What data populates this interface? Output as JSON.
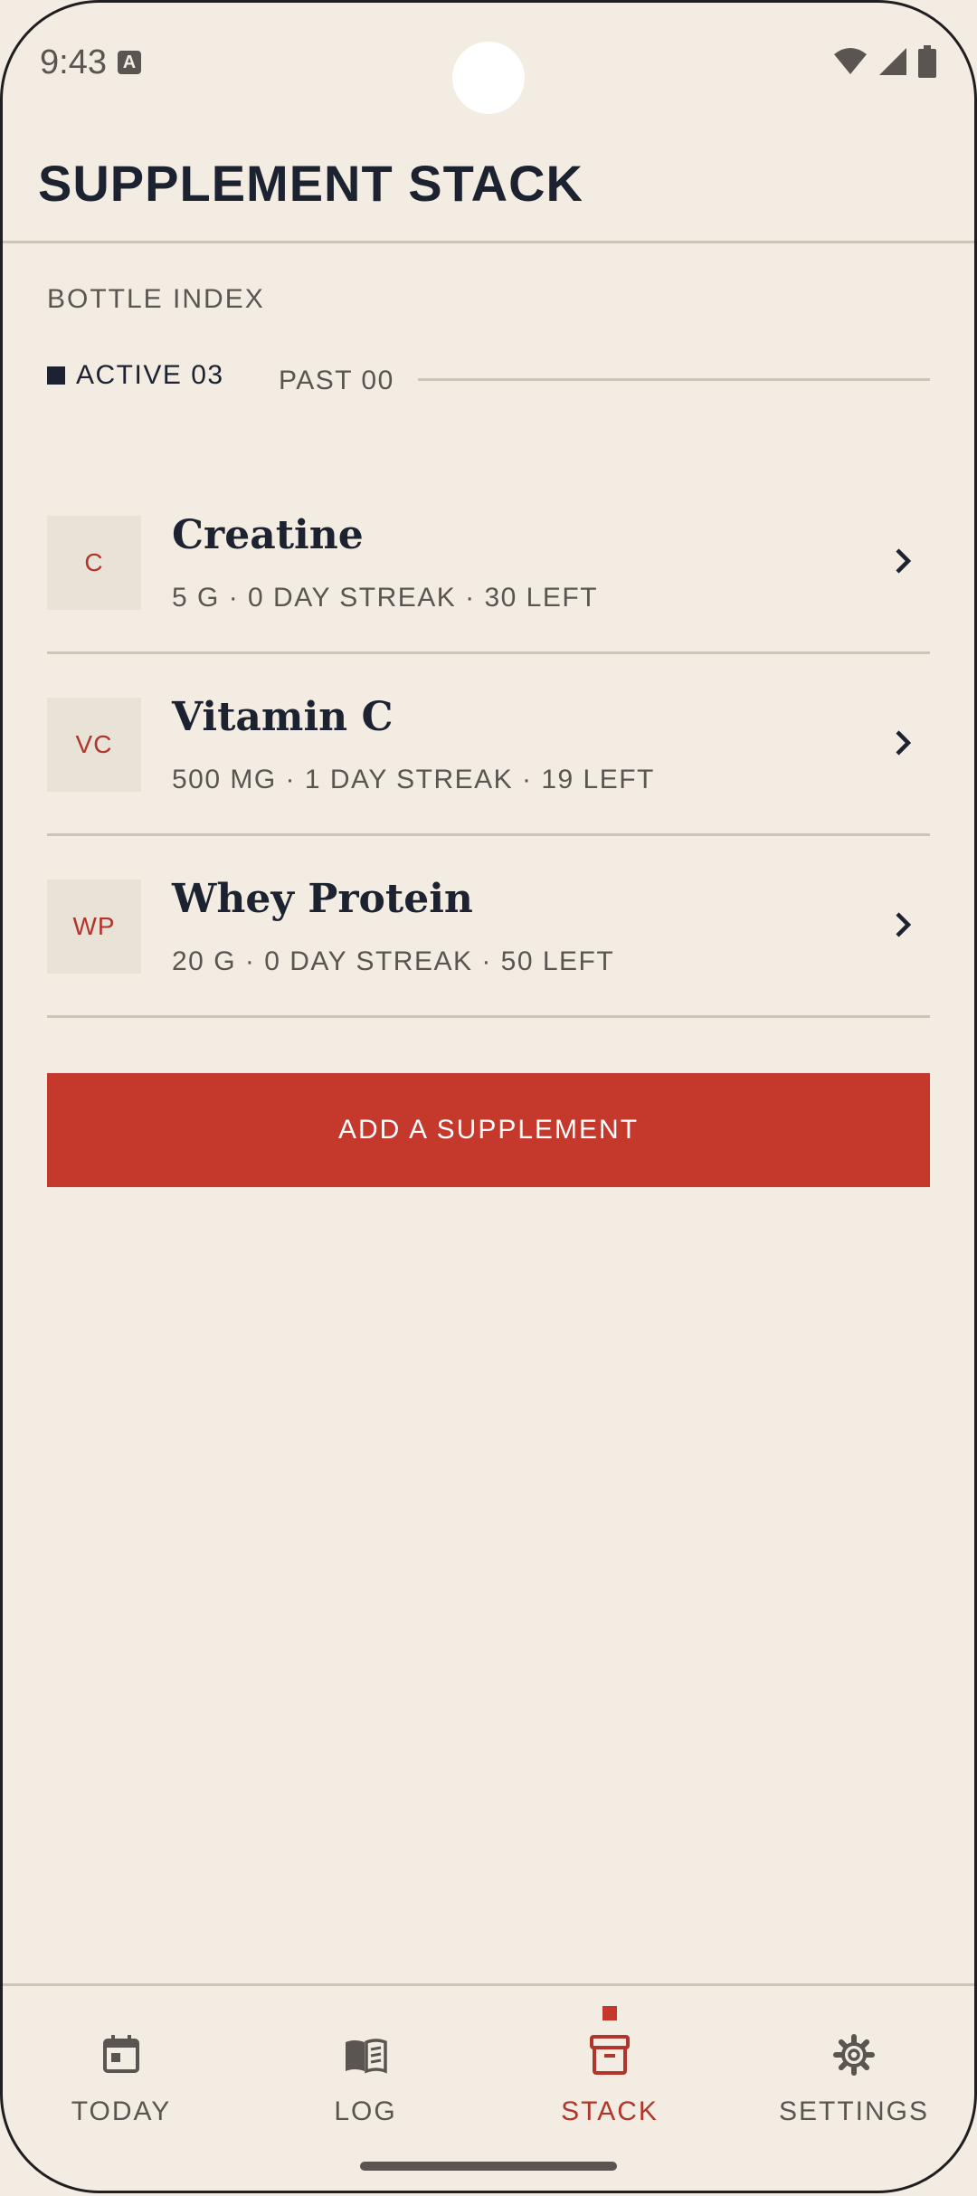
{
  "status_bar": {
    "time": "9:43"
  },
  "app_bar": {
    "title": "SUPPLEMENT STACK"
  },
  "section": {
    "label": "BOTTLE INDEX"
  },
  "tabs": {
    "active": "ACTIVE 03",
    "past": "PAST 00"
  },
  "supplements": [
    {
      "initials": "C",
      "name": "Creatine",
      "meta": "5 G · 0 DAY STREAK · 30 LEFT"
    },
    {
      "initials": "VC",
      "name": "Vitamin C",
      "meta": "500 MG · 1 DAY STREAK · 19 LEFT"
    },
    {
      "initials": "WP",
      "name": "Whey Protein",
      "meta": "20 G · 0 DAY STREAK · 50 LEFT"
    }
  ],
  "add_button": {
    "label": "ADD A SUPPLEMENT"
  },
  "nav": {
    "items": [
      {
        "label": "TODAY",
        "icon": "calendar-icon"
      },
      {
        "label": "LOG",
        "icon": "book-icon"
      },
      {
        "label": "STACK",
        "icon": "archive-box-icon",
        "active": true
      },
      {
        "label": "SETTINGS",
        "icon": "gear-icon"
      }
    ]
  },
  "colors": {
    "background": "#f2ece3",
    "accent": "#c4392b",
    "ink": "#1c2230",
    "muted": "#5a5550"
  }
}
